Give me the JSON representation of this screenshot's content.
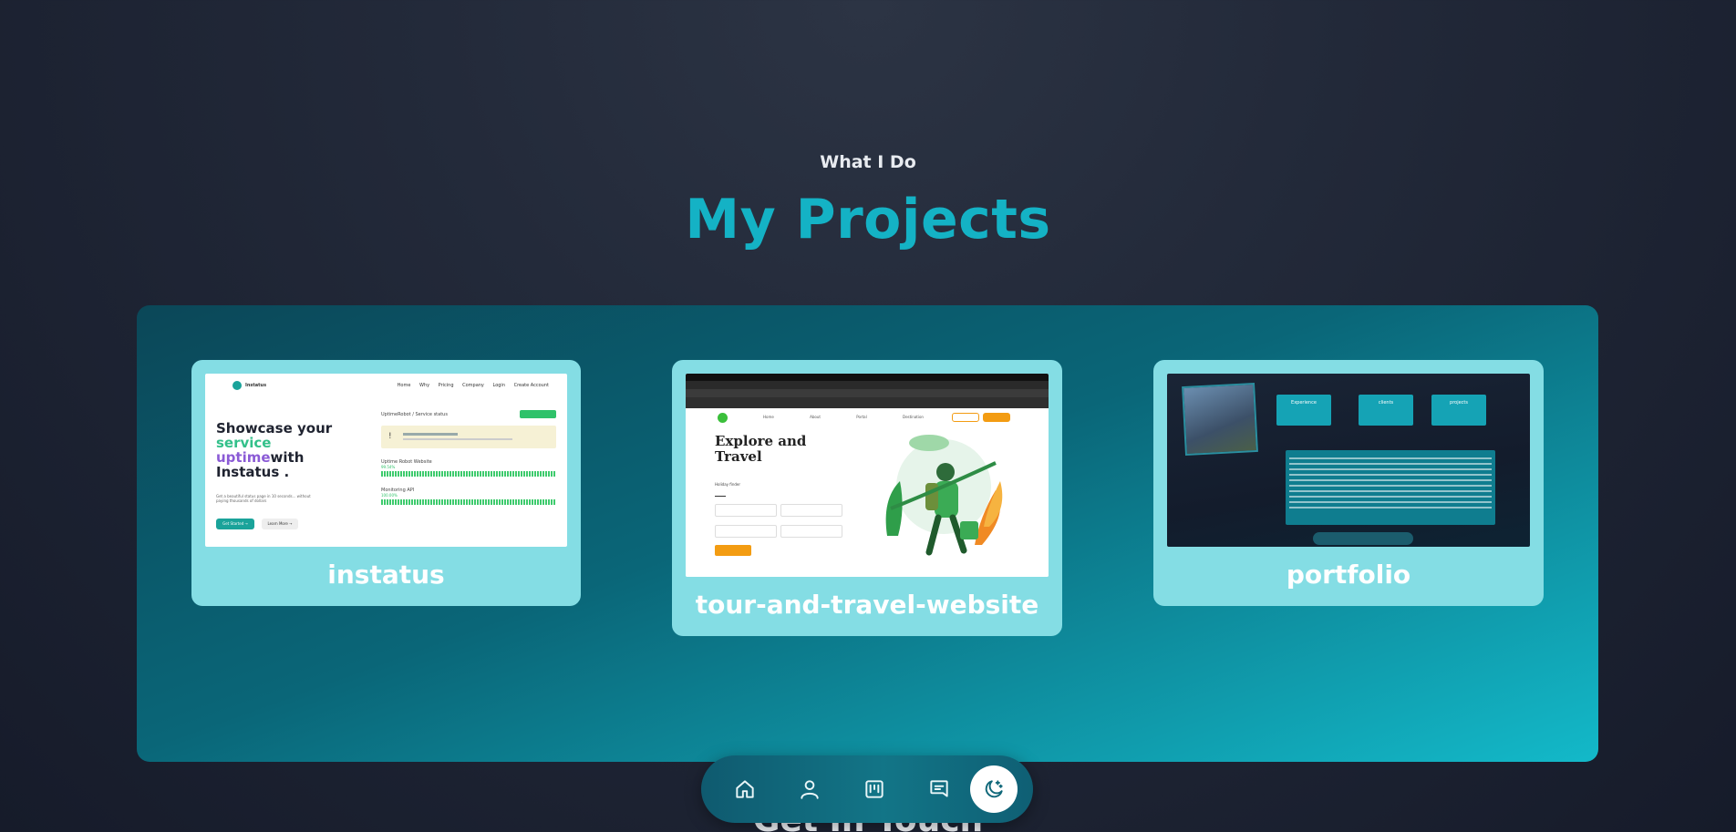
{
  "section": {
    "eyebrow": "What I Do",
    "title": "My Projects"
  },
  "projects": [
    {
      "title": "instatus",
      "thumbnail": {
        "brand": "Instatus",
        "nav_links": [
          "Home",
          "Why",
          "Pricing",
          "Company",
          "Login",
          "Create Account"
        ],
        "hero_line1": "Showcase your",
        "hero_line2": "service",
        "hero_line3a": "uptime",
        "hero_line3b": "with",
        "hero_line4": "Instatus .",
        "subtext": "Get a beautiful status page in 10 seconds... without paying thousands of dollars",
        "cta_primary": "Get Started →",
        "cta_secondary": "Learn More →",
        "panel_header": "UptimeRobot / Service status",
        "services": [
          {
            "name": "Uptime Robot Website",
            "uptime": "99.54%"
          },
          {
            "name": "Monitoring API",
            "uptime": "100.00%"
          }
        ]
      }
    },
    {
      "title": "tour-and-travel-website",
      "thumbnail": {
        "hero_line1": "Explore and",
        "hero_line2": "Travel",
        "date_label": "Holiday finder",
        "nav_links": [
          "Home",
          "About",
          "Portal",
          "Destination"
        ]
      }
    },
    {
      "title": "portfolio",
      "thumbnail": {
        "stats": [
          {
            "label": "Experience"
          },
          {
            "label": "clients"
          },
          {
            "label": "projects"
          }
        ]
      }
    }
  ],
  "dock": {
    "items": [
      {
        "icon": "home-icon"
      },
      {
        "icon": "user-icon"
      },
      {
        "icon": "projects-board-icon"
      },
      {
        "icon": "message-icon"
      },
      {
        "icon": "moon-sparkle-icon",
        "active": true
      }
    ]
  },
  "next_section_title": "Get In Touch",
  "colors": {
    "accent": "#14b2c5",
    "card_bg": "#84dde4",
    "panel_start": "#0b4758",
    "panel_end": "#13b9c9"
  }
}
